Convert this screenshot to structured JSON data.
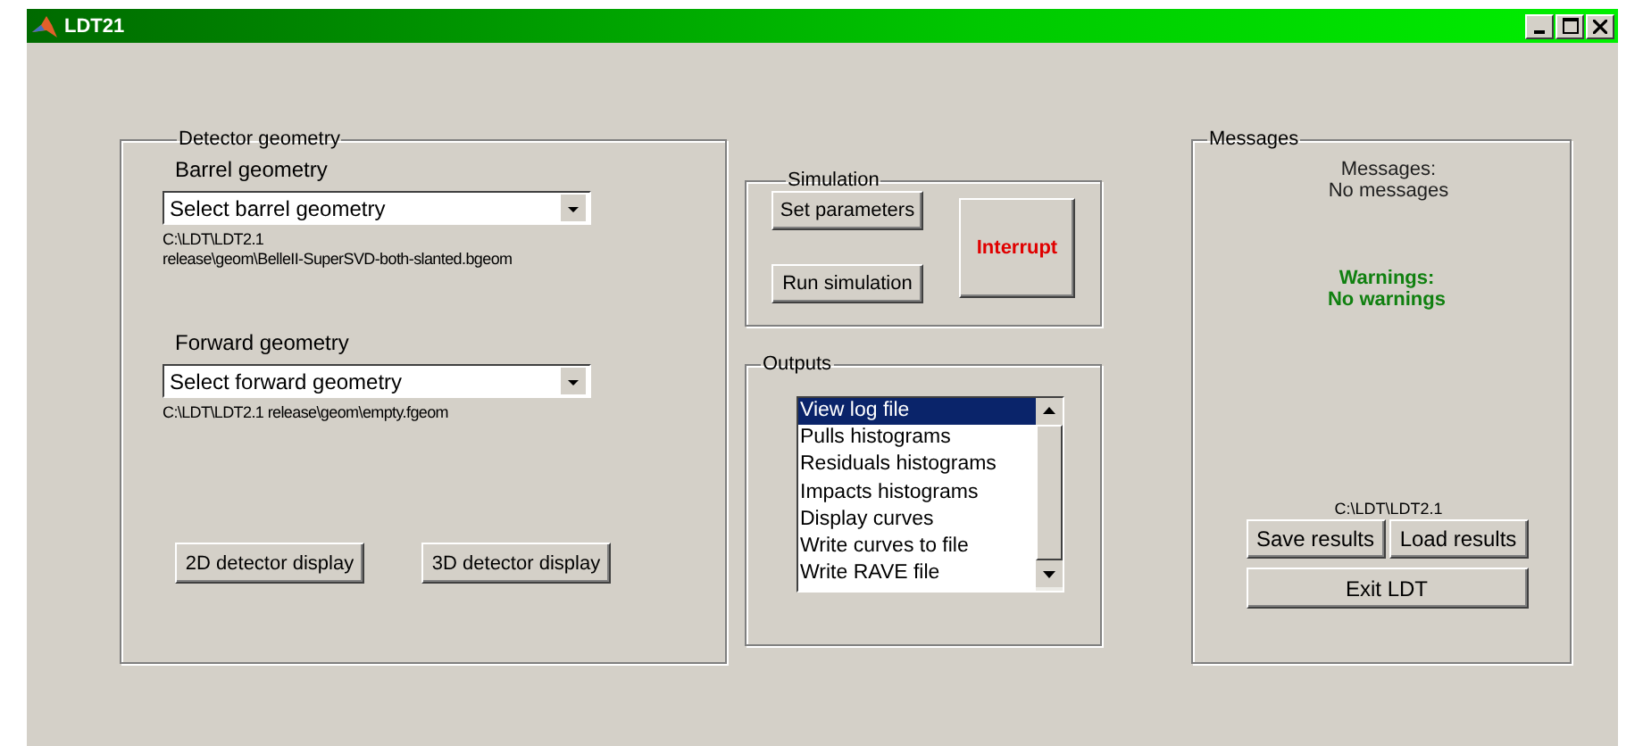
{
  "window": {
    "title": "LDT21"
  },
  "detector_geometry": {
    "title": "Detector geometry",
    "barrel": {
      "label": "Barrel geometry",
      "value": "Select barrel geometry",
      "path_lines": [
        "C:\\LDT\\LDT2.1",
        "release\\geom\\BelleII-SuperSVD-both-slanted.bgeom"
      ]
    },
    "forward": {
      "label": "Forward geometry",
      "value": "Select forward geometry",
      "path": "C:\\LDT\\LDT2.1 release\\geom\\empty.fgeom"
    },
    "buttons": [
      "2D detector display",
      "3D detector display"
    ]
  },
  "simulation": {
    "title": "Simulation",
    "buttons": [
      "Set parameters",
      "Run simulation"
    ],
    "interrupt": "Interrupt"
  },
  "outputs": {
    "title": "Outputs",
    "items": [
      {
        "label": "View log file",
        "selected": true
      },
      {
        "label": "Pulls histograms",
        "selected": false
      },
      {
        "label": "Residuals histograms",
        "selected": false
      },
      {
        "label": "Impacts histograms",
        "selected": false
      },
      {
        "label": "Display curves",
        "selected": false
      },
      {
        "label": "Write curves to file",
        "selected": false
      },
      {
        "label": "Write RAVE file",
        "selected": false
      }
    ]
  },
  "messages": {
    "title": "Messages",
    "messages_label": "Messages:",
    "messages_text": "No messages",
    "warnings_label": "Warnings:",
    "warnings_text": "No warnings",
    "path": "C:\\LDT\\LDT2.1",
    "buttons": [
      "Save results",
      "Load results"
    ],
    "exit": "Exit LDT"
  }
}
